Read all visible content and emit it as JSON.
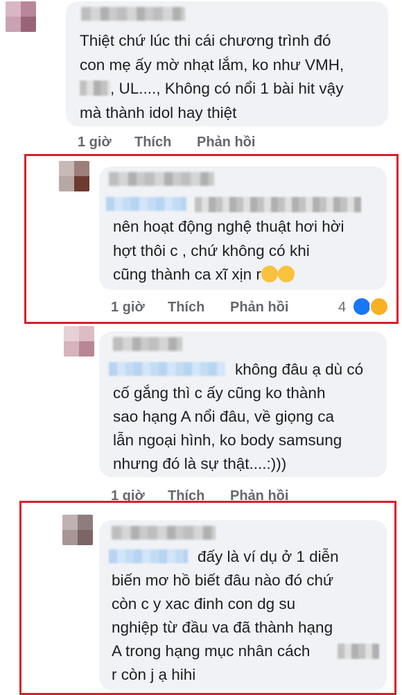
{
  "comments": [
    {
      "id": "c1",
      "author": "",
      "lines": [
        "Thiệt chứ lúc thi cái chương trình đó",
        "con mẹ ấy mờ nhạt lắm, ko như VMH,",
        ", UL...., Không có nổi 1 bài hit vậy",
        "mà thành idol hay thiệt"
      ],
      "time": "1 giờ",
      "like": "Thích",
      "reply": "Phản hồi"
    },
    {
      "id": "c2",
      "lines": [
        "nên hoạt động nghệ thuật hơi hời",
        "hợt thôi c , chứ không có khi",
        "cũng thành ca xĩ xịn r"
      ],
      "time": "1 giờ",
      "like": "Thích",
      "reply": "Phản hồi",
      "reaction_count": "4",
      "highlighted": true
    },
    {
      "id": "c3",
      "lines": [
        "không đâu ạ dù có",
        "cố gắng thì c ấy cũng ko thành",
        "sao hạng A nổi đâu, về giọng ca",
        "lẫn ngoại hình, ko body samsung",
        "nhưng đó là sự thật....:)))"
      ],
      "time": "1 giờ",
      "like": "Thích",
      "reply": "Phản hồi"
    },
    {
      "id": "c4",
      "lines": [
        "đấy là ví dụ ở 1 diễn",
        "biến mơ hồ biết đâu nào đó chứ",
        "còn c y xac đinh con dg su",
        "nghiệp từ đầu va đã thành hạng",
        "A trong hạng mục nhân cách",
        "r còn j ạ hihi"
      ],
      "highlighted": true
    }
  ],
  "colors": {
    "highlight_border": "#d6202c",
    "bubble_bg": "#f0f2f5",
    "meta_text": "#65676b",
    "like_blue": "#1877f2",
    "haha_yellow": "#f7b125"
  },
  "icons": [
    "like-reaction-icon",
    "haha-reaction-icon",
    "crying-emoji-icon"
  ]
}
